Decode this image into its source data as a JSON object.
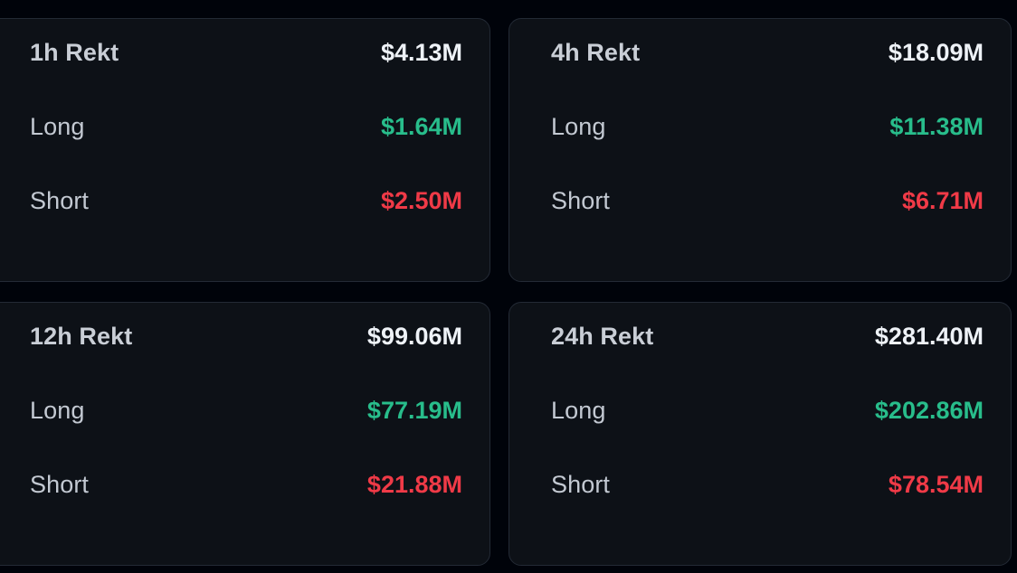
{
  "theme": {
    "page_background": "#00030a",
    "card_background": "#0d1117",
    "card_border": "#232a35",
    "label_color": "#c3c9d2",
    "total_color": "#eef2f7",
    "long_color": "#28bd8b",
    "short_color": "#f03a47"
  },
  "labels": {
    "long": "Long",
    "short": "Short"
  },
  "cards": [
    {
      "title": "1h Rekt",
      "total": "$4.13M",
      "long_label": "Long",
      "long": "$1.64M",
      "short_label": "Short",
      "short": "$2.50M"
    },
    {
      "title": "4h Rekt",
      "total": "$18.09M",
      "long_label": "Long",
      "long": "$11.38M",
      "short_label": "Short",
      "short": "$6.71M"
    },
    {
      "title": "12h Rekt",
      "total": "$99.06M",
      "long_label": "Long",
      "long": "$77.19M",
      "short_label": "Short",
      "short": "$21.88M"
    },
    {
      "title": "24h Rekt",
      "total": "$281.40M",
      "long_label": "Long",
      "long": "$202.86M",
      "short_label": "Short",
      "short": "$78.54M"
    }
  ]
}
